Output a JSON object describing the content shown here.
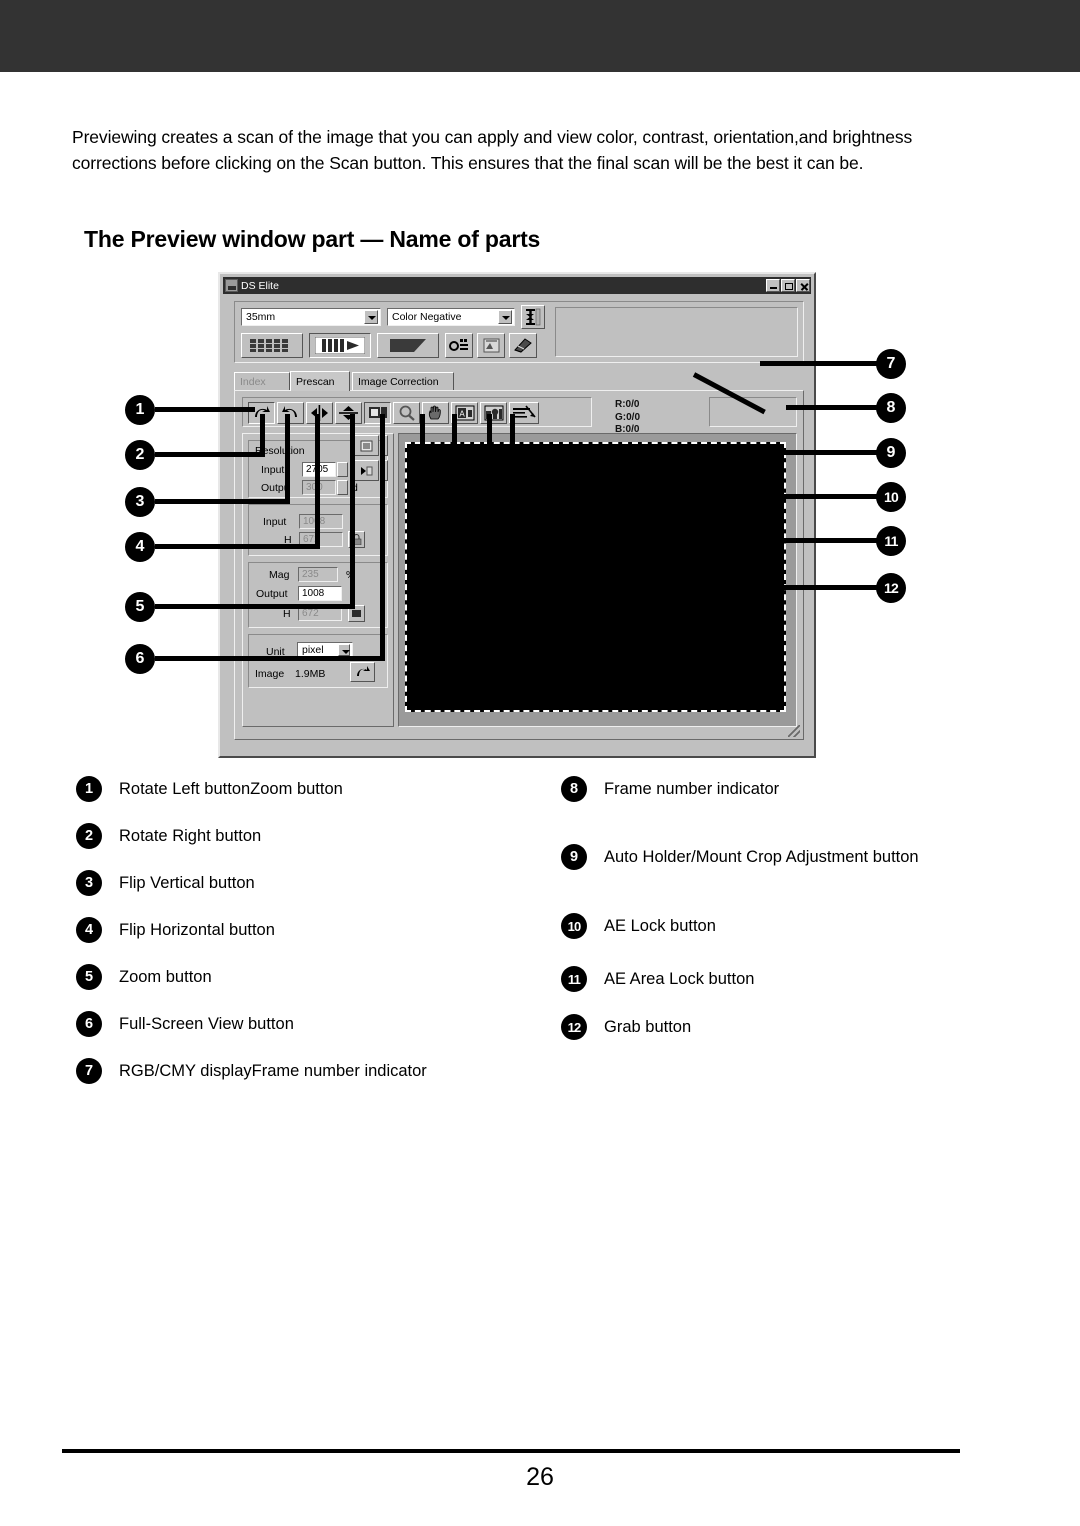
{
  "page": {
    "number": "26",
    "intro": "Previewing creates a scan of the image that you can apply and view color, contrast, orientation,and brightness corrections before clicking on the Scan button. This ensures that the final scan will be the best it can be.",
    "heading": "The Preview window part — Name of parts"
  },
  "app": {
    "title": "DS Elite",
    "window_buttons": {
      "minimize": "minimize",
      "maximize": "maximize",
      "close": "close"
    },
    "film_format": {
      "value": "35mm"
    },
    "film_type": {
      "value": "Color Negative"
    },
    "tabs": [
      {
        "label": "Index",
        "state": "disabled"
      },
      {
        "label": "Prescan",
        "state": "active"
      },
      {
        "label": "Image Correction",
        "state": "normal"
      }
    ],
    "rgb_display": {
      "r": "R:0/0",
      "g": "G:0/0",
      "b": "B:0/0"
    },
    "settings": {
      "resolution_group": "Resolution",
      "res_input_label": "Input",
      "res_input_value": "2705",
      "res_input_unit": "d",
      "res_output_label": "Outpu",
      "res_output_value": "300",
      "res_output_unit": "d",
      "size_input_label": "Input",
      "size_input_value": "1008",
      "size_h_label": "H",
      "size_h_value": "672",
      "mag_label": "Mag",
      "mag_value": "235",
      "mag_unit": "%",
      "out_label": "Output",
      "out_value": "1008",
      "out_h_label": "H",
      "out_h_value": "672",
      "unit_label": "Unit",
      "unit_value": "pixel",
      "image_label": "Image",
      "image_size": "1.9MB"
    },
    "toolbar_icons": [
      "rotate-left-icon",
      "rotate-right-icon",
      "flip-horizontal-icon",
      "flip-vertical-icon",
      "full-screen-view-icon",
      "zoom-icon",
      "grab-hand-icon",
      "ae-lock-icon",
      "ae-area-lock-icon",
      "auto-crop-icon"
    ],
    "top_buttons": [
      "index-scan-icon",
      "prescan-icon",
      "scan-icon",
      "eject-icon",
      "settings-icon",
      "help-icon",
      "preferences-icon"
    ]
  },
  "callouts": {
    "left": [
      "1",
      "2",
      "3",
      "4",
      "5",
      "6"
    ],
    "right": [
      "7",
      "8",
      "9",
      "10",
      "11",
      "12"
    ]
  },
  "legend": {
    "left_column": [
      {
        "num": "1",
        "text": "Rotate Left buttonZoom button"
      },
      {
        "num": "2",
        "text": "Rotate Right button"
      },
      {
        "num": "3",
        "text": "Flip Vertical button"
      },
      {
        "num": "4",
        "text": "Flip Horizontal button"
      },
      {
        "num": "5",
        "text": "Zoom button"
      },
      {
        "num": "6",
        "text": "Full-Screen View button"
      },
      {
        "num": "7",
        "text": "RGB/CMY displayFrame number indicator"
      }
    ],
    "right_column": [
      {
        "num": "8",
        "text": "Frame number indicator"
      },
      {
        "num": "9",
        "text": "Auto Holder/Mount Crop Adjustment button"
      },
      {
        "num": "10",
        "text": "AE Lock button"
      },
      {
        "num": "11",
        "text": "AE Area Lock button"
      },
      {
        "num": "12",
        "text": "Grab button"
      }
    ]
  },
  "colors": {
    "band": "#333333",
    "window_face": "#c0c0c0",
    "titlebar": "#2e2e2e",
    "preview_bg": "#000000"
  }
}
